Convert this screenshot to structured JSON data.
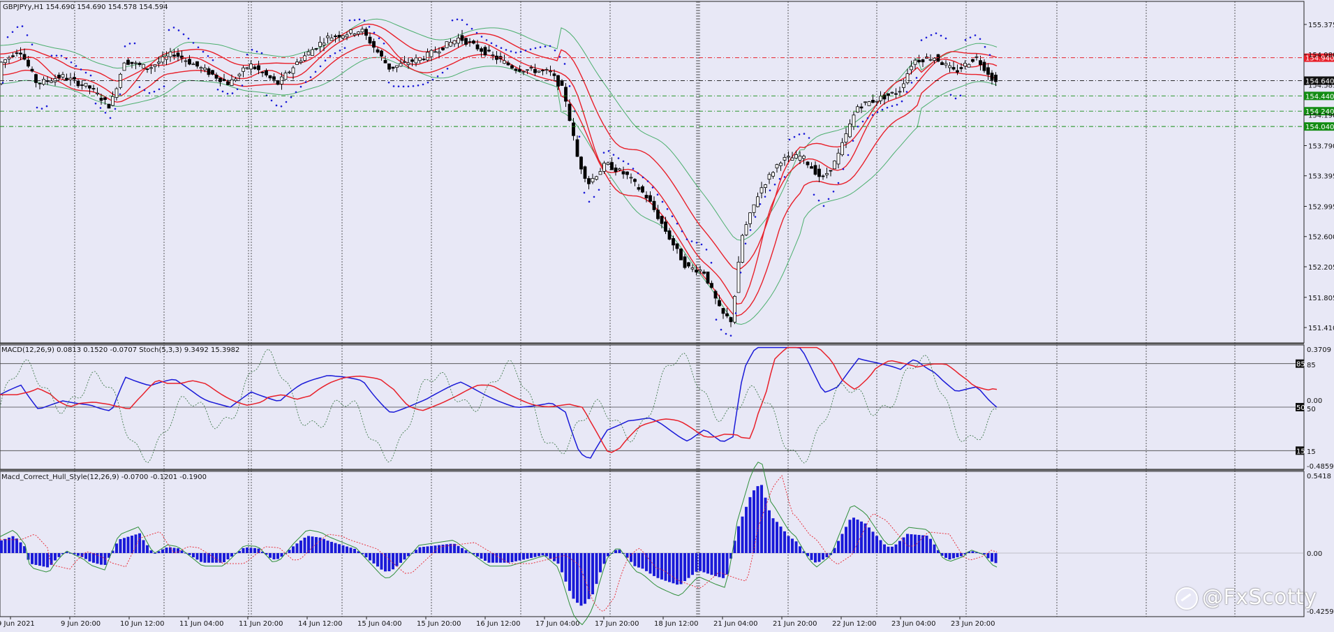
{
  "main": {
    "header": "GBPJPYy,H1  154.690 154.690 154.578 154.594",
    "price_ticks": [
      "155.375",
      "154.980",
      "154.585",
      "154.190",
      "153.790",
      "153.395",
      "152.995",
      "152.600",
      "152.205",
      "151.805",
      "151.410"
    ],
    "levels": [
      {
        "value": "154.940",
        "color": "#e8202a",
        "name": "level-red"
      },
      {
        "value": "154.640",
        "color": "#111111",
        "name": "level-current"
      },
      {
        "value": "154.440",
        "color": "#138c13",
        "name": "level-green-1"
      },
      {
        "value": "154.240",
        "color": "#138c13",
        "name": "level-green-2"
      },
      {
        "value": "154.040",
        "color": "#138c13",
        "name": "level-green-3"
      }
    ]
  },
  "macd_panel": {
    "header": "MACD(12,26,9) 0.0813 0.1520 -0.0707  Stoch(5,3,3) 9.3492 15.3982",
    "ticks": [
      "0.3709",
      "85",
      "0.00",
      "50",
      "15",
      "-0.4859"
    ]
  },
  "hull_panel": {
    "header": "Macd_Correct_Hull_Style(12,26,9) -0.0700 -0.1201 -0.1900",
    "ticks": [
      "0.5418",
      "0.00",
      "-0.4259"
    ]
  },
  "time_axis": [
    "9 Jun 2021",
    "9 Jun 20:00",
    "10 Jun 12:00",
    "11 Jun 04:00",
    "11 Jun 20:00",
    "14 Jun 12:00",
    "15 Jun 04:00",
    "15 Jun 20:00",
    "16 Jun 12:00",
    "17 Jun 04:00",
    "17 Jun 20:00",
    "18 Jun 12:00",
    "21 Jun 04:00",
    "21 Jun 20:00",
    "22 Jun 12:00",
    "23 Jun 04:00",
    "23 Jun 20:00"
  ],
  "watermark": "@FxScotty",
  "colors": {
    "background": "#e8e8f6",
    "bands": "#e8202a",
    "envelope": "#4caf6e",
    "sar": "#1a1ad8",
    "macd": "#1a1ad8",
    "signal": "#e8202a",
    "histogram": "#1a1ad8"
  }
}
